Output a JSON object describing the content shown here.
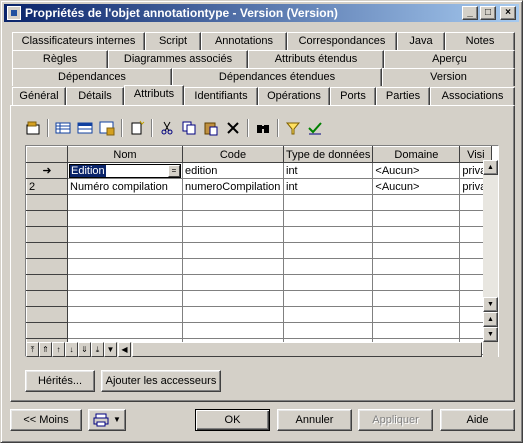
{
  "window": {
    "title": "Propriétés de l'objet annotationtype - Version (Version)"
  },
  "titlebar": {
    "minimize": "_",
    "maximize": "□",
    "close": "×"
  },
  "tabs": {
    "row1": [
      "Classificateurs internes",
      "Script",
      "Annotations",
      "Correspondances",
      "Java",
      "Notes"
    ],
    "row2": [
      "Règles",
      "Diagrammes associés",
      "Attributs étendus",
      "Aperçu"
    ],
    "row3": [
      "Dépendances",
      "Dépendances étendues",
      "Version"
    ],
    "row4": [
      "Général",
      "Détails",
      "Attributs",
      "Identifiants",
      "Opérations",
      "Ports",
      "Parties",
      "Associations"
    ],
    "active": "Attributs"
  },
  "toolbar": {
    "icons": [
      "properties-icon",
      "add-row-icon",
      "insert-row-icon",
      "add-rows-icon",
      "new-icon",
      "cut-icon",
      "copy-icon",
      "paste-icon",
      "delete-icon",
      "find-icon",
      "filter-icon",
      "check-icon"
    ]
  },
  "grid": {
    "columns": [
      "Nom",
      "Code",
      "Type de données",
      "Domaine",
      "Visi"
    ],
    "rows": [
      {
        "marker": "➜",
        "nom": "Edition",
        "code": "edition",
        "type": "int",
        "domaine": "<Aucun>",
        "visi": "privat"
      },
      {
        "marker": "2",
        "nom": "Numéro compilation",
        "code": "numeroCompilation",
        "type": "int",
        "domaine": "<Aucun>",
        "visi": "privat"
      }
    ],
    "empty_rows": 10
  },
  "buttons": {
    "herites": "Hérités...",
    "ajouter": "Ajouter les accesseurs",
    "moins": "<< Moins",
    "ok": "OK",
    "annuler": "Annuler",
    "appliquer": "Appliquer",
    "aide": "Aide"
  }
}
